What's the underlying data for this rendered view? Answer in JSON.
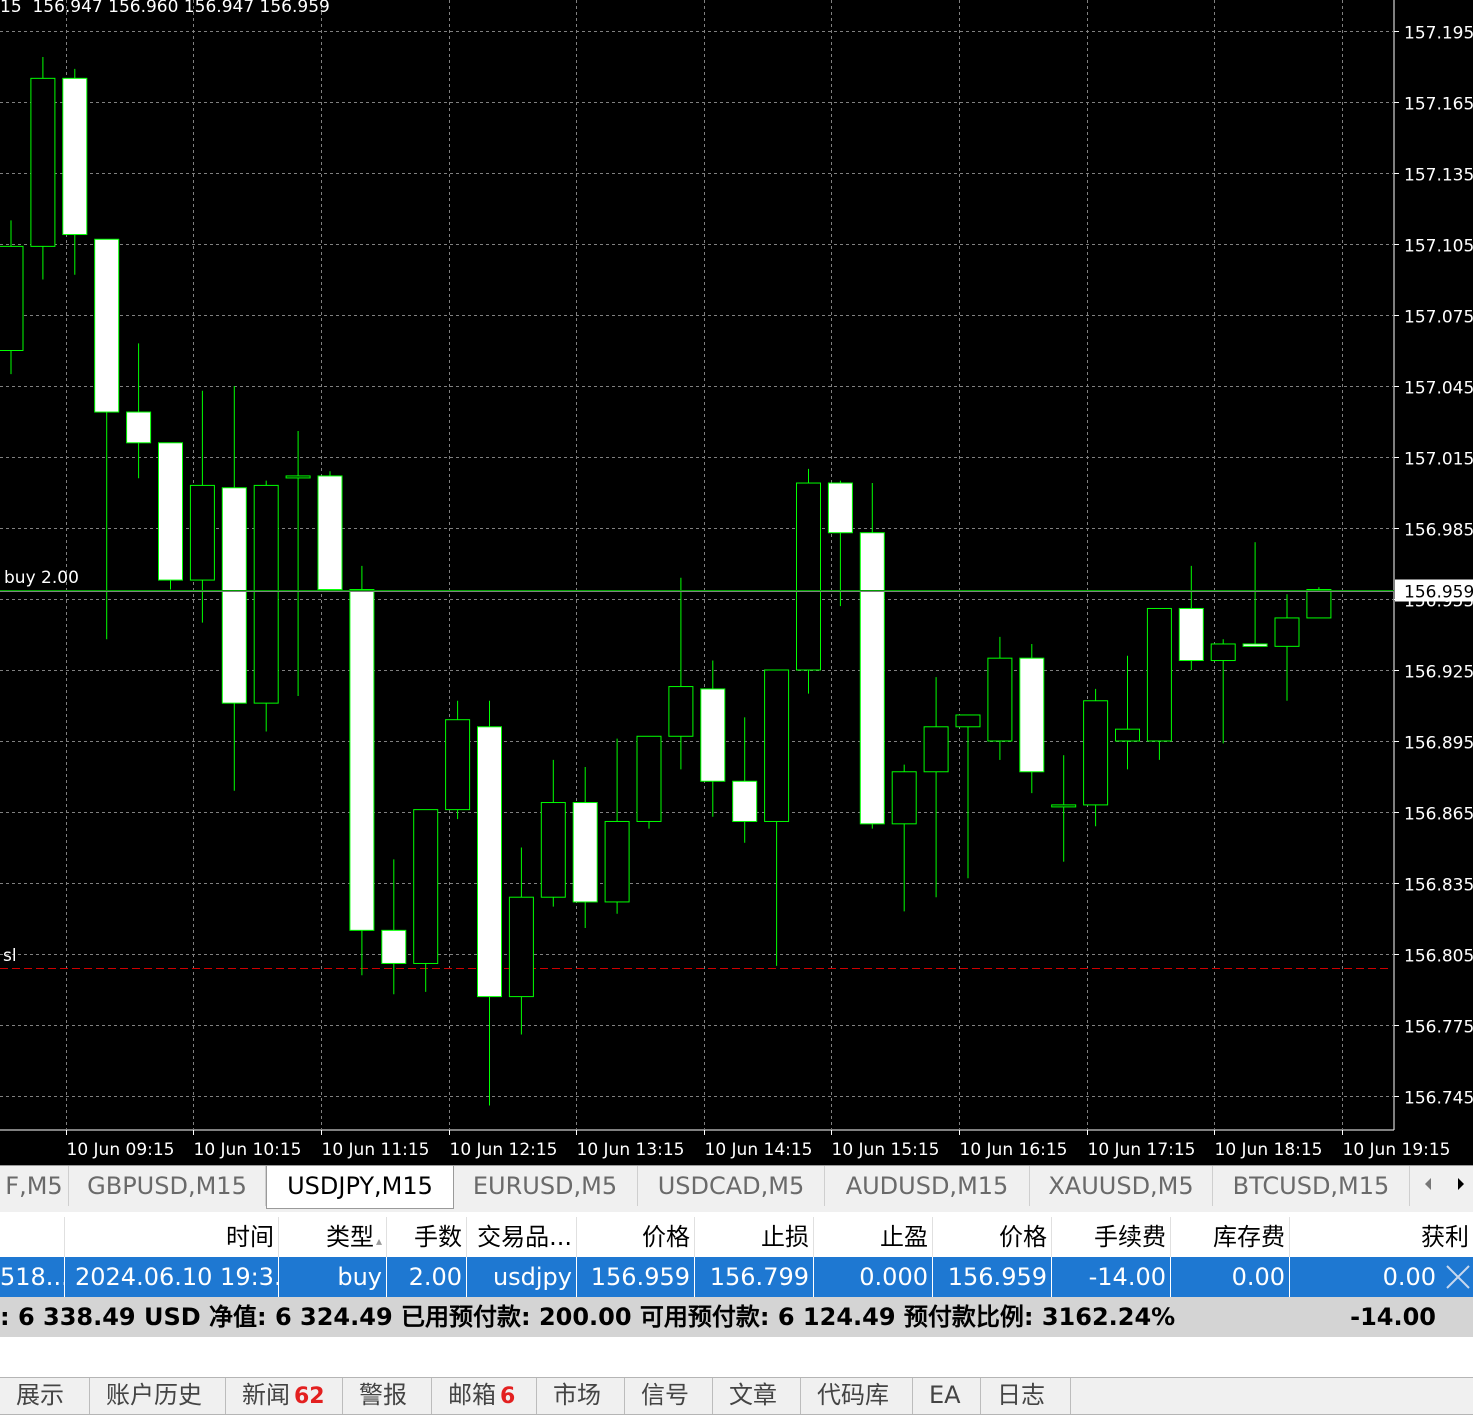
{
  "chart": {
    "ohlc_text": "15  156.947 156.960 156.947 156.959",
    "buy_label": "buy 2.00",
    "sl_label": "sl",
    "current_price": "156.959",
    "colors": {
      "background": "#000000",
      "grid": "#808080",
      "wick": "#00ff00",
      "candle_fill": "#ffffff",
      "sl_line": "#cc0000",
      "price_line": "#808080"
    }
  },
  "chart_data": {
    "type": "candlestick",
    "symbol": "USDJPY",
    "timeframe": "M15",
    "y_ticks": [
      157.195,
      157.165,
      157.135,
      157.105,
      157.075,
      157.045,
      157.015,
      156.985,
      156.955,
      156.925,
      156.895,
      156.865,
      156.835,
      156.805,
      156.775,
      156.745
    ],
    "y_tick_labels": [
      "157.195",
      "157.165",
      "157.135",
      "157.105",
      "157.075",
      "157.045",
      "157.015",
      "156.985",
      "156.955",
      "156.925",
      "156.895",
      "156.865",
      "156.835",
      "156.805",
      "156.775",
      "156.745"
    ],
    "ylim": [
      156.73,
      157.207
    ],
    "x_labels": [
      "10 Jun 09:15",
      "10 Jun 10:15",
      "10 Jun 11:15",
      "10 Jun 12:15",
      "10 Jun 13:15",
      "10 Jun 14:15",
      "10 Jun 15:15",
      "10 Jun 16:15",
      "10 Jun 17:15",
      "10 Jun 18:15",
      "10 Jun 19:15"
    ],
    "x_label_candle_index": [
      2,
      6,
      10,
      14,
      18,
      22,
      26,
      30,
      34,
      38,
      42
    ],
    "candles": [
      {
        "o": 157.06,
        "h": 157.115,
        "l": 157.05,
        "c": 157.104
      },
      {
        "o": 157.104,
        "h": 157.184,
        "l": 157.09,
        "c": 157.175
      },
      {
        "o": 157.175,
        "h": 157.179,
        "l": 157.092,
        "c": 157.109
      },
      {
        "o": 157.107,
        "h": 157.102,
        "l": 156.938,
        "c": 157.034
      },
      {
        "o": 157.034,
        "h": 157.063,
        "l": 157.006,
        "c": 157.021
      },
      {
        "o": 157.021,
        "h": 157.02,
        "l": 156.959,
        "c": 156.963
      },
      {
        "o": 156.963,
        "h": 157.043,
        "l": 156.945,
        "c": 157.003
      },
      {
        "o": 157.002,
        "h": 157.045,
        "l": 156.874,
        "c": 156.911
      },
      {
        "o": 156.911,
        "h": 157.005,
        "l": 156.899,
        "c": 157.003
      },
      {
        "o": 157.007,
        "h": 157.026,
        "l": 156.914,
        "c": 157.007
      },
      {
        "o": 157.007,
        "h": 157.009,
        "l": 156.959,
        "c": 156.959
      },
      {
        "o": 156.959,
        "h": 156.969,
        "l": 156.796,
        "c": 156.815
      },
      {
        "o": 156.815,
        "h": 156.845,
        "l": 156.788,
        "c": 156.801
      },
      {
        "o": 156.801,
        "h": 156.866,
        "l": 156.789,
        "c": 156.866
      },
      {
        "o": 156.866,
        "h": 156.912,
        "l": 156.862,
        "c": 156.904
      },
      {
        "o": 156.901,
        "h": 156.912,
        "l": 156.741,
        "c": 156.787
      },
      {
        "o": 156.787,
        "h": 156.85,
        "l": 156.771,
        "c": 156.829
      },
      {
        "o": 156.829,
        "h": 156.887,
        "l": 156.825,
        "c": 156.869
      },
      {
        "o": 156.869,
        "h": 156.884,
        "l": 156.816,
        "c": 156.827
      },
      {
        "o": 156.827,
        "h": 156.896,
        "l": 156.822,
        "c": 156.861
      },
      {
        "o": 156.861,
        "h": 156.893,
        "l": 156.858,
        "c": 156.897
      },
      {
        "o": 156.897,
        "h": 156.964,
        "l": 156.883,
        "c": 156.918
      },
      {
        "o": 156.917,
        "h": 156.929,
        "l": 156.863,
        "c": 156.878
      },
      {
        "o": 156.878,
        "h": 156.905,
        "l": 156.852,
        "c": 156.861
      },
      {
        "o": 156.861,
        "h": 156.925,
        "l": 156.8,
        "c": 156.925
      },
      {
        "o": 156.925,
        "h": 157.01,
        "l": 156.915,
        "c": 157.004
      },
      {
        "o": 157.004,
        "h": 157.005,
        "l": 156.952,
        "c": 156.983
      },
      {
        "o": 156.983,
        "h": 157.004,
        "l": 156.858,
        "c": 156.86
      },
      {
        "o": 156.86,
        "h": 156.885,
        "l": 156.823,
        "c": 156.882
      },
      {
        "o": 156.882,
        "h": 156.922,
        "l": 156.829,
        "c": 156.901
      },
      {
        "o": 156.901,
        "h": 156.906,
        "l": 156.837,
        "c": 156.906
      },
      {
        "o": 156.895,
        "h": 156.939,
        "l": 156.887,
        "c": 156.93
      },
      {
        "o": 156.93,
        "h": 156.936,
        "l": 156.873,
        "c": 156.882
      },
      {
        "o": 156.868,
        "h": 156.889,
        "l": 156.844,
        "c": 156.868
      },
      {
        "o": 156.868,
        "h": 156.917,
        "l": 156.859,
        "c": 156.912
      },
      {
        "o": 156.895,
        "h": 156.931,
        "l": 156.883,
        "c": 156.9
      },
      {
        "o": 156.895,
        "h": 156.938,
        "l": 156.887,
        "c": 156.951
      },
      {
        "o": 156.951,
        "h": 156.969,
        "l": 156.925,
        "c": 156.929
      },
      {
        "o": 156.929,
        "h": 156.938,
        "l": 156.894,
        "c": 156.936
      },
      {
        "o": 156.936,
        "h": 156.979,
        "l": 156.935,
        "c": 156.935
      },
      {
        "o": 156.935,
        "h": 156.957,
        "l": 156.912,
        "c": 156.947
      },
      {
        "o": 156.947,
        "h": 156.96,
        "l": 156.947,
        "c": 156.959
      }
    ],
    "horizontal_lines": [
      {
        "label": "buy 2.00",
        "price": 156.959
      },
      {
        "label": "sl",
        "price": 156.799
      }
    ]
  },
  "symbol_tabs": [
    "F,M5",
    "GBPUSD,M15",
    "USDJPY,M15",
    "EURUSD,M5",
    "USDCAD,M5",
    "AUDUSD,M15",
    "XAUUSD,M5",
    "BTCUSD,M15"
  ],
  "active_symbol_tab": "USDJPY,M15",
  "tab_scroll": {
    "left_icon": "triangle-left-icon",
    "right_icon": "triangle-right-icon"
  },
  "trade_table": {
    "headers": {
      "ticket": "",
      "time": "时间",
      "type": "类型",
      "volume": "手数",
      "symbol": "交易品...",
      "price": "价格",
      "sl": "止损",
      "tp": "止盈",
      "current_price": "价格",
      "commission": "手续费",
      "swap": "库存费",
      "profit": "获利"
    },
    "rows": [
      {
        "ticket": "518...",
        "time": "2024.06.10 19:3...",
        "type": "buy",
        "volume": "2.00",
        "symbol": "usdjpy",
        "price": "156.959",
        "sl": "156.799",
        "tp": "0.000",
        "current_price": "156.959",
        "commission": "-14.00",
        "swap": "0.00",
        "profit": "0.00"
      }
    ],
    "summary": {
      "text": ": 6 338.49 USD  净值: 6 324.49  已用预付款: 200.00  可用预付款: 6 124.49  预付款比例: 3162.24%",
      "profit": "-14.00"
    },
    "close_icon": "close-x-icon"
  },
  "bottom_tabs": [
    {
      "label": "展示",
      "badge": ""
    },
    {
      "label": "账户历史",
      "badge": ""
    },
    {
      "label": "新闻",
      "badge": "62"
    },
    {
      "label": "警报",
      "badge": ""
    },
    {
      "label": "邮箱",
      "badge": "6"
    },
    {
      "label": "市场",
      "badge": ""
    },
    {
      "label": "信号",
      "badge": ""
    },
    {
      "label": "文章",
      "badge": ""
    },
    {
      "label": "代码库",
      "badge": ""
    },
    {
      "label": "EA",
      "badge": ""
    },
    {
      "label": "日志",
      "badge": ""
    }
  ]
}
